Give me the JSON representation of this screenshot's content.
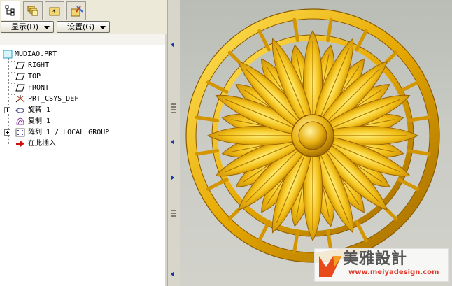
{
  "toolbar": {
    "display_button": "显示(D)",
    "settings_button": "设置(G)"
  },
  "tree": {
    "root": "MUDIAO.PRT",
    "items": [
      {
        "label": "RIGHT",
        "icon": "datum-plane-icon"
      },
      {
        "label": "TOP",
        "icon": "datum-plane-icon"
      },
      {
        "label": "FRONT",
        "icon": "datum-plane-icon"
      },
      {
        "label": "PRT_CSYS_DEF",
        "icon": "csys-icon"
      },
      {
        "label": "旋转 1",
        "icon": "revolve-icon"
      },
      {
        "label": "复制 1",
        "icon": "copy-icon"
      },
      {
        "label": "阵列 1 / LOCAL_GROUP",
        "icon": "pattern-icon"
      },
      {
        "label": "在此插入",
        "icon": "insert-here-arrow-icon"
      }
    ]
  },
  "watermark": {
    "brand": "美雅設計",
    "url": "www.meiyadesign.com"
  },
  "colors": {
    "gold": "#e6a800",
    "gold_light": "#ffe45c",
    "gold_dark": "#a86e00",
    "insert_arrow": "#cc1010",
    "viewport_bg": "#c5c7c0"
  }
}
